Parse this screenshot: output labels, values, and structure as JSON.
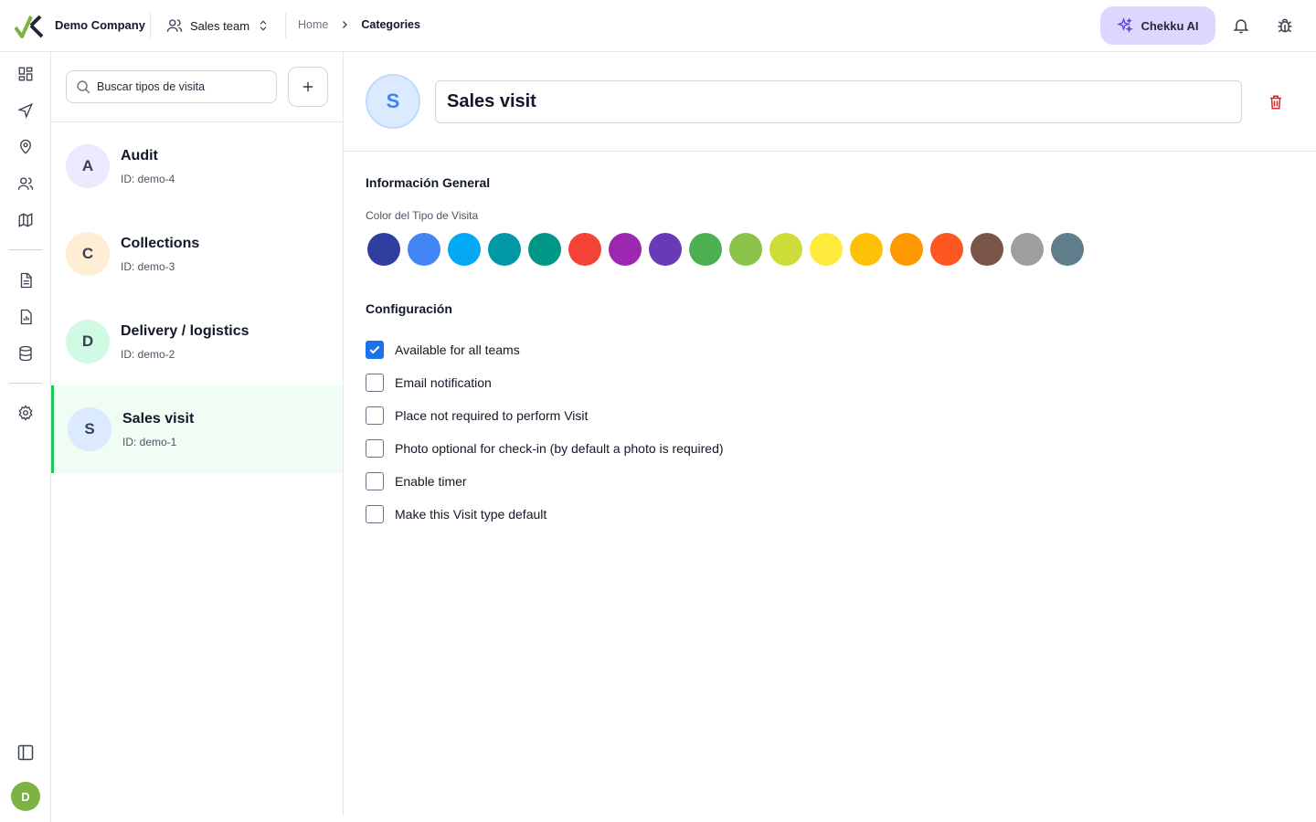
{
  "header": {
    "company": "Demo Company",
    "team": "Sales team",
    "breadcrumb": {
      "home": "Home",
      "current": "Categories"
    },
    "ai_button": "Chekku AI"
  },
  "rail": {
    "icons": [
      "dashboard-icon",
      "send-icon",
      "location-pin-icon",
      "users-icon",
      "map-icon",
      "document-icon",
      "report-icon",
      "database-icon",
      "settings-icon"
    ],
    "user_initial": "D"
  },
  "list": {
    "search_placeholder": "Buscar tipos de visita",
    "items": [
      {
        "initial": "A",
        "name": "Audit",
        "id": "ID: demo-4",
        "color": "#ede9fe"
      },
      {
        "initial": "C",
        "name": "Collections",
        "id": "ID: demo-3",
        "color": "#ffedd5"
      },
      {
        "initial": "D",
        "name": "Delivery / logistics",
        "id": "ID: demo-2",
        "color": "#d1fae5"
      },
      {
        "initial": "S",
        "name": "Sales visit",
        "id": "ID: demo-1",
        "color": "#dbeafe",
        "selected": true
      }
    ]
  },
  "detail": {
    "initial": "S",
    "name": "Sales visit",
    "general_title": "Información General",
    "color_label": "Color del Tipo de Visita",
    "colors": [
      "#303f9f",
      "#4285f4",
      "#03a9f4",
      "#0097a7",
      "#009688",
      "#f44336",
      "#9c27b0",
      "#673ab7",
      "#4caf50",
      "#8bc34a",
      "#cddc39",
      "#ffeb3b",
      "#ffc107",
      "#ff9800",
      "#ff5722",
      "#795548",
      "#9e9e9e",
      "#607d8b"
    ],
    "config_title": "Configuración",
    "options": [
      {
        "label": "Available for all teams",
        "checked": true
      },
      {
        "label": "Email notification",
        "checked": false
      },
      {
        "label": "Place not required to perform Visit",
        "checked": false
      },
      {
        "label": "Photo optional for check-in (by default a photo is required)",
        "checked": false
      },
      {
        "label": "Enable timer",
        "checked": false
      },
      {
        "label": "Make this Visit type default",
        "checked": false
      }
    ]
  }
}
